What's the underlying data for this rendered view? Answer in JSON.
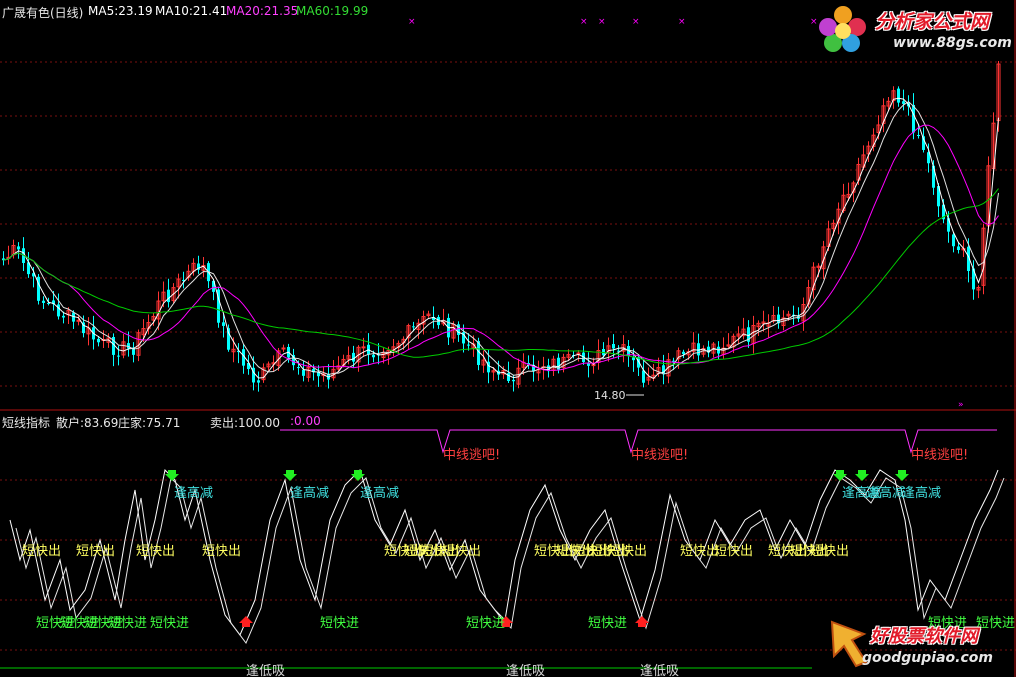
{
  "main_panel": {
    "stock_title": "广晟有色(日线)",
    "ma5": "MA5:23.19",
    "ma10": "MA10:21.41",
    "ma20": "MA20:21.35",
    "ma60": "MA60:19.99",
    "low_price_marker": "14.80",
    "colors": {
      "ma5": "#ffffff",
      "ma10": "#ffffff",
      "ma20": "#ff00ff",
      "ma60": "#00cc00",
      "up_candle": "#ff3333",
      "down_candle": "#00ffff"
    }
  },
  "indicator_panel": {
    "name": "短线指标",
    "retail": "散户:83.69",
    "dealer": "庄家:75.71",
    "sell": "卖出:100.00",
    "extra": ":0.00",
    "labels": {
      "mid_escape": "中线逃吧!",
      "sell_high": "逢高减",
      "short_out": "短快出",
      "short_in": "短快进",
      "buy_low": "逢低吸"
    }
  },
  "watermarks": {
    "top_cn": "分析家公式网",
    "top_url": "www.88gs.com",
    "bottom_cn": "好股票软件网",
    "bottom_url": "goodgupiao.com"
  }
}
